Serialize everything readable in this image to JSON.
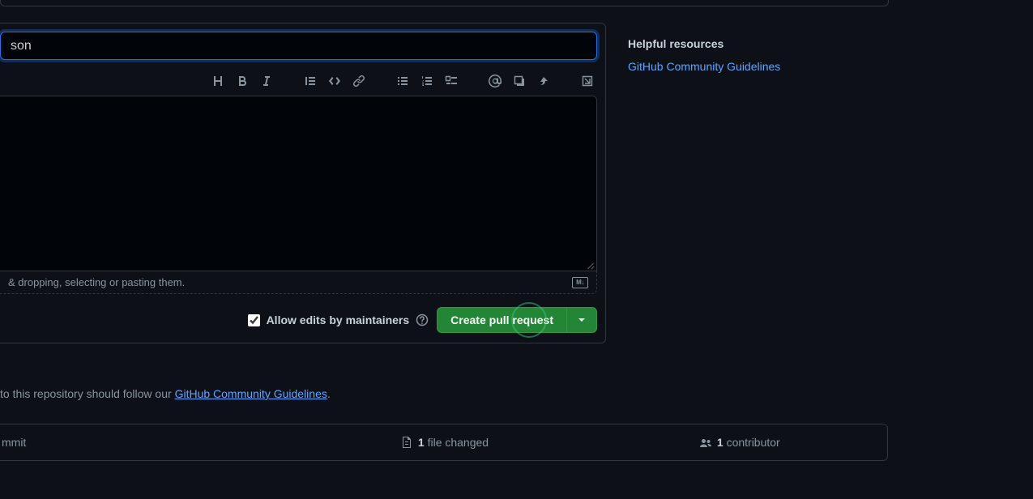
{
  "title_input": {
    "value": "son"
  },
  "attach_bar": {
    "hint": "& dropping, selecting or pasting them."
  },
  "actions": {
    "allow_edits_label": "Allow edits by maintainers",
    "create_pr_label": "Create pull request"
  },
  "guideline_note": {
    "prefix": " to this repository should follow our ",
    "link_text": "GitHub Community Guidelines",
    "suffix": "."
  },
  "stats": {
    "commit": {
      "label": "mmit"
    },
    "files": {
      "count": "1",
      "label": " file changed"
    },
    "contributors": {
      "count": "1",
      "label": " contributor"
    }
  },
  "sidebar": {
    "heading": "Helpful resources",
    "link_text": "GitHub Community Guidelines"
  }
}
